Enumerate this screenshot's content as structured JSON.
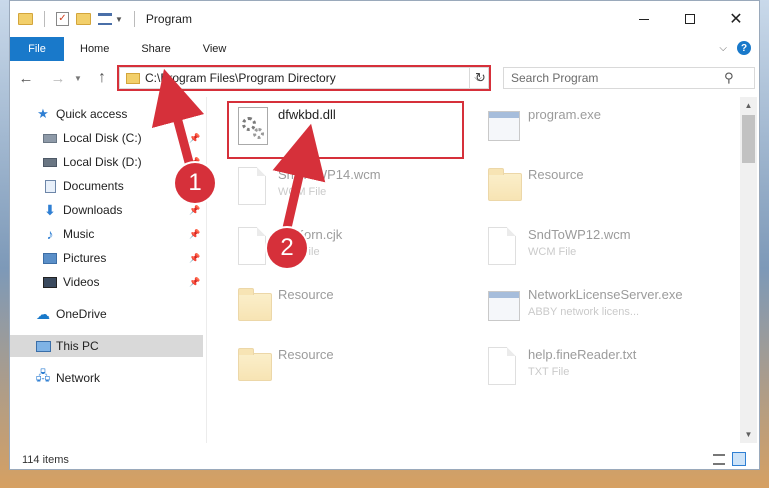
{
  "window": {
    "title": "Program"
  },
  "ribbon": {
    "file": "File",
    "tabs": [
      "Home",
      "Share",
      "View"
    ]
  },
  "address": {
    "path": "C:\\Program Files\\Program Directory"
  },
  "search": {
    "placeholder": "Search Program"
  },
  "nav": {
    "items": [
      {
        "label": "Quick access",
        "icon": "star-icon",
        "pinned": false
      },
      {
        "label": "Local Disk (C:)",
        "icon": "drive-icon",
        "pinned": true
      },
      {
        "label": "Local Disk (D:)",
        "icon": "drive-icon",
        "pinned": true
      },
      {
        "label": "Documents",
        "icon": "documents-icon",
        "pinned": true
      },
      {
        "label": "Downloads",
        "icon": "download-arrow-icon",
        "pinned": true
      },
      {
        "label": "Music",
        "icon": "music-note-icon",
        "pinned": true
      },
      {
        "label": "Pictures",
        "icon": "pictures-icon",
        "pinned": true
      },
      {
        "label": "Videos",
        "icon": "videos-icon",
        "pinned": true
      },
      {
        "label": "OneDrive",
        "icon": "cloud-icon",
        "pinned": false
      },
      {
        "label": "This PC",
        "icon": "computer-icon",
        "pinned": false,
        "selected": true
      },
      {
        "label": "Network",
        "icon": "network-icon",
        "pinned": false
      }
    ]
  },
  "files": [
    {
      "name": "dfwkbd.dll",
      "type": "",
      "icon": "dll-gear-icon",
      "highlighted": true
    },
    {
      "name": "program.exe",
      "type": "",
      "icon": "exe-icon"
    },
    {
      "name": "SndToWP14.wcm",
      "type": "WCM File",
      "icon": "blank-file-icon"
    },
    {
      "name": "Resource",
      "type": "",
      "icon": "folder-icon"
    },
    {
      "name": "FwKorn.cjk",
      "type": "CJK File",
      "icon": "blank-file-icon"
    },
    {
      "name": "SndToWP12.wcm",
      "type": "WCM File",
      "icon": "blank-file-icon"
    },
    {
      "name": "Resource",
      "type": "",
      "icon": "folder-icon"
    },
    {
      "name": "NetworkLicenseServer.exe",
      "type": "ABBY network licens...",
      "icon": "exe-icon"
    },
    {
      "name": "Resource",
      "type": "",
      "icon": "folder-icon"
    },
    {
      "name": "help.fineReader.txt",
      "type": "TXT File",
      "icon": "blank-file-icon"
    }
  ],
  "status": {
    "count": "114 items"
  },
  "annotations": {
    "callout1": "1",
    "callout2": "2"
  },
  "colors": {
    "accent": "#1979ca",
    "annotation": "#d6303a"
  }
}
